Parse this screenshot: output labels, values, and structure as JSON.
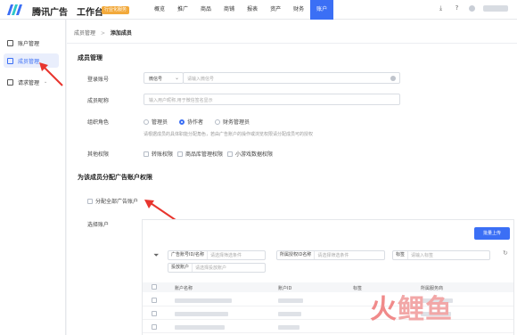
{
  "header": {
    "brand": "腾讯广告",
    "workbench": "工作台",
    "badge": "行业化服务",
    "nav": [
      "概览",
      "推广",
      "商品",
      "商铺",
      "报表",
      "资产",
      "财务",
      "账户"
    ],
    "active_nav": "账户"
  },
  "sidebar": {
    "items": [
      {
        "label": "账户管理"
      },
      {
        "label": "成员管理"
      },
      {
        "label": "请求管理"
      }
    ]
  },
  "breadcrumb": {
    "parent": "成员管理",
    "sep": ">",
    "current": "添加成员"
  },
  "member_section": {
    "title": "成员管理",
    "login_label": "登录账号",
    "login_type": "微信号",
    "login_placeholder": "请输入微信号",
    "name_label": "成员昵称",
    "name_placeholder": "输入用户昵称,用于微信签名显示",
    "role_label": "组织角色",
    "roles": [
      "管理员",
      "协作者",
      "财务管理员"
    ],
    "selected_role": "协作者",
    "role_hint": "请根据成员的具体职能分配角色，若由广告账户的操作或浏览权限请分配成员可的授权",
    "other_label": "其他权限",
    "other_perms": [
      "转账权限",
      "商品库管理权限",
      "小游戏数据权限"
    ]
  },
  "assign_section": {
    "title": "为该成员分配广告账户权限",
    "assign_all": "分配全部广告账户",
    "select_label": "选择账户",
    "batch_button": "批量上传",
    "filters": [
      {
        "key": "广告账号ID/名称",
        "value": "请选择筛选条件"
      },
      {
        "key": "所属授权ID名称",
        "value": "请选择筛选条件"
      },
      {
        "key": "标签",
        "value": "请输入标签"
      },
      {
        "key": "投放账户",
        "value": "请选择投放账户"
      }
    ],
    "columns": [
      "账户名称",
      "账户ID",
      "标签",
      "所属服务商"
    ]
  },
  "watermark": {
    "part1": "火",
    "part2": "鲤鱼"
  }
}
